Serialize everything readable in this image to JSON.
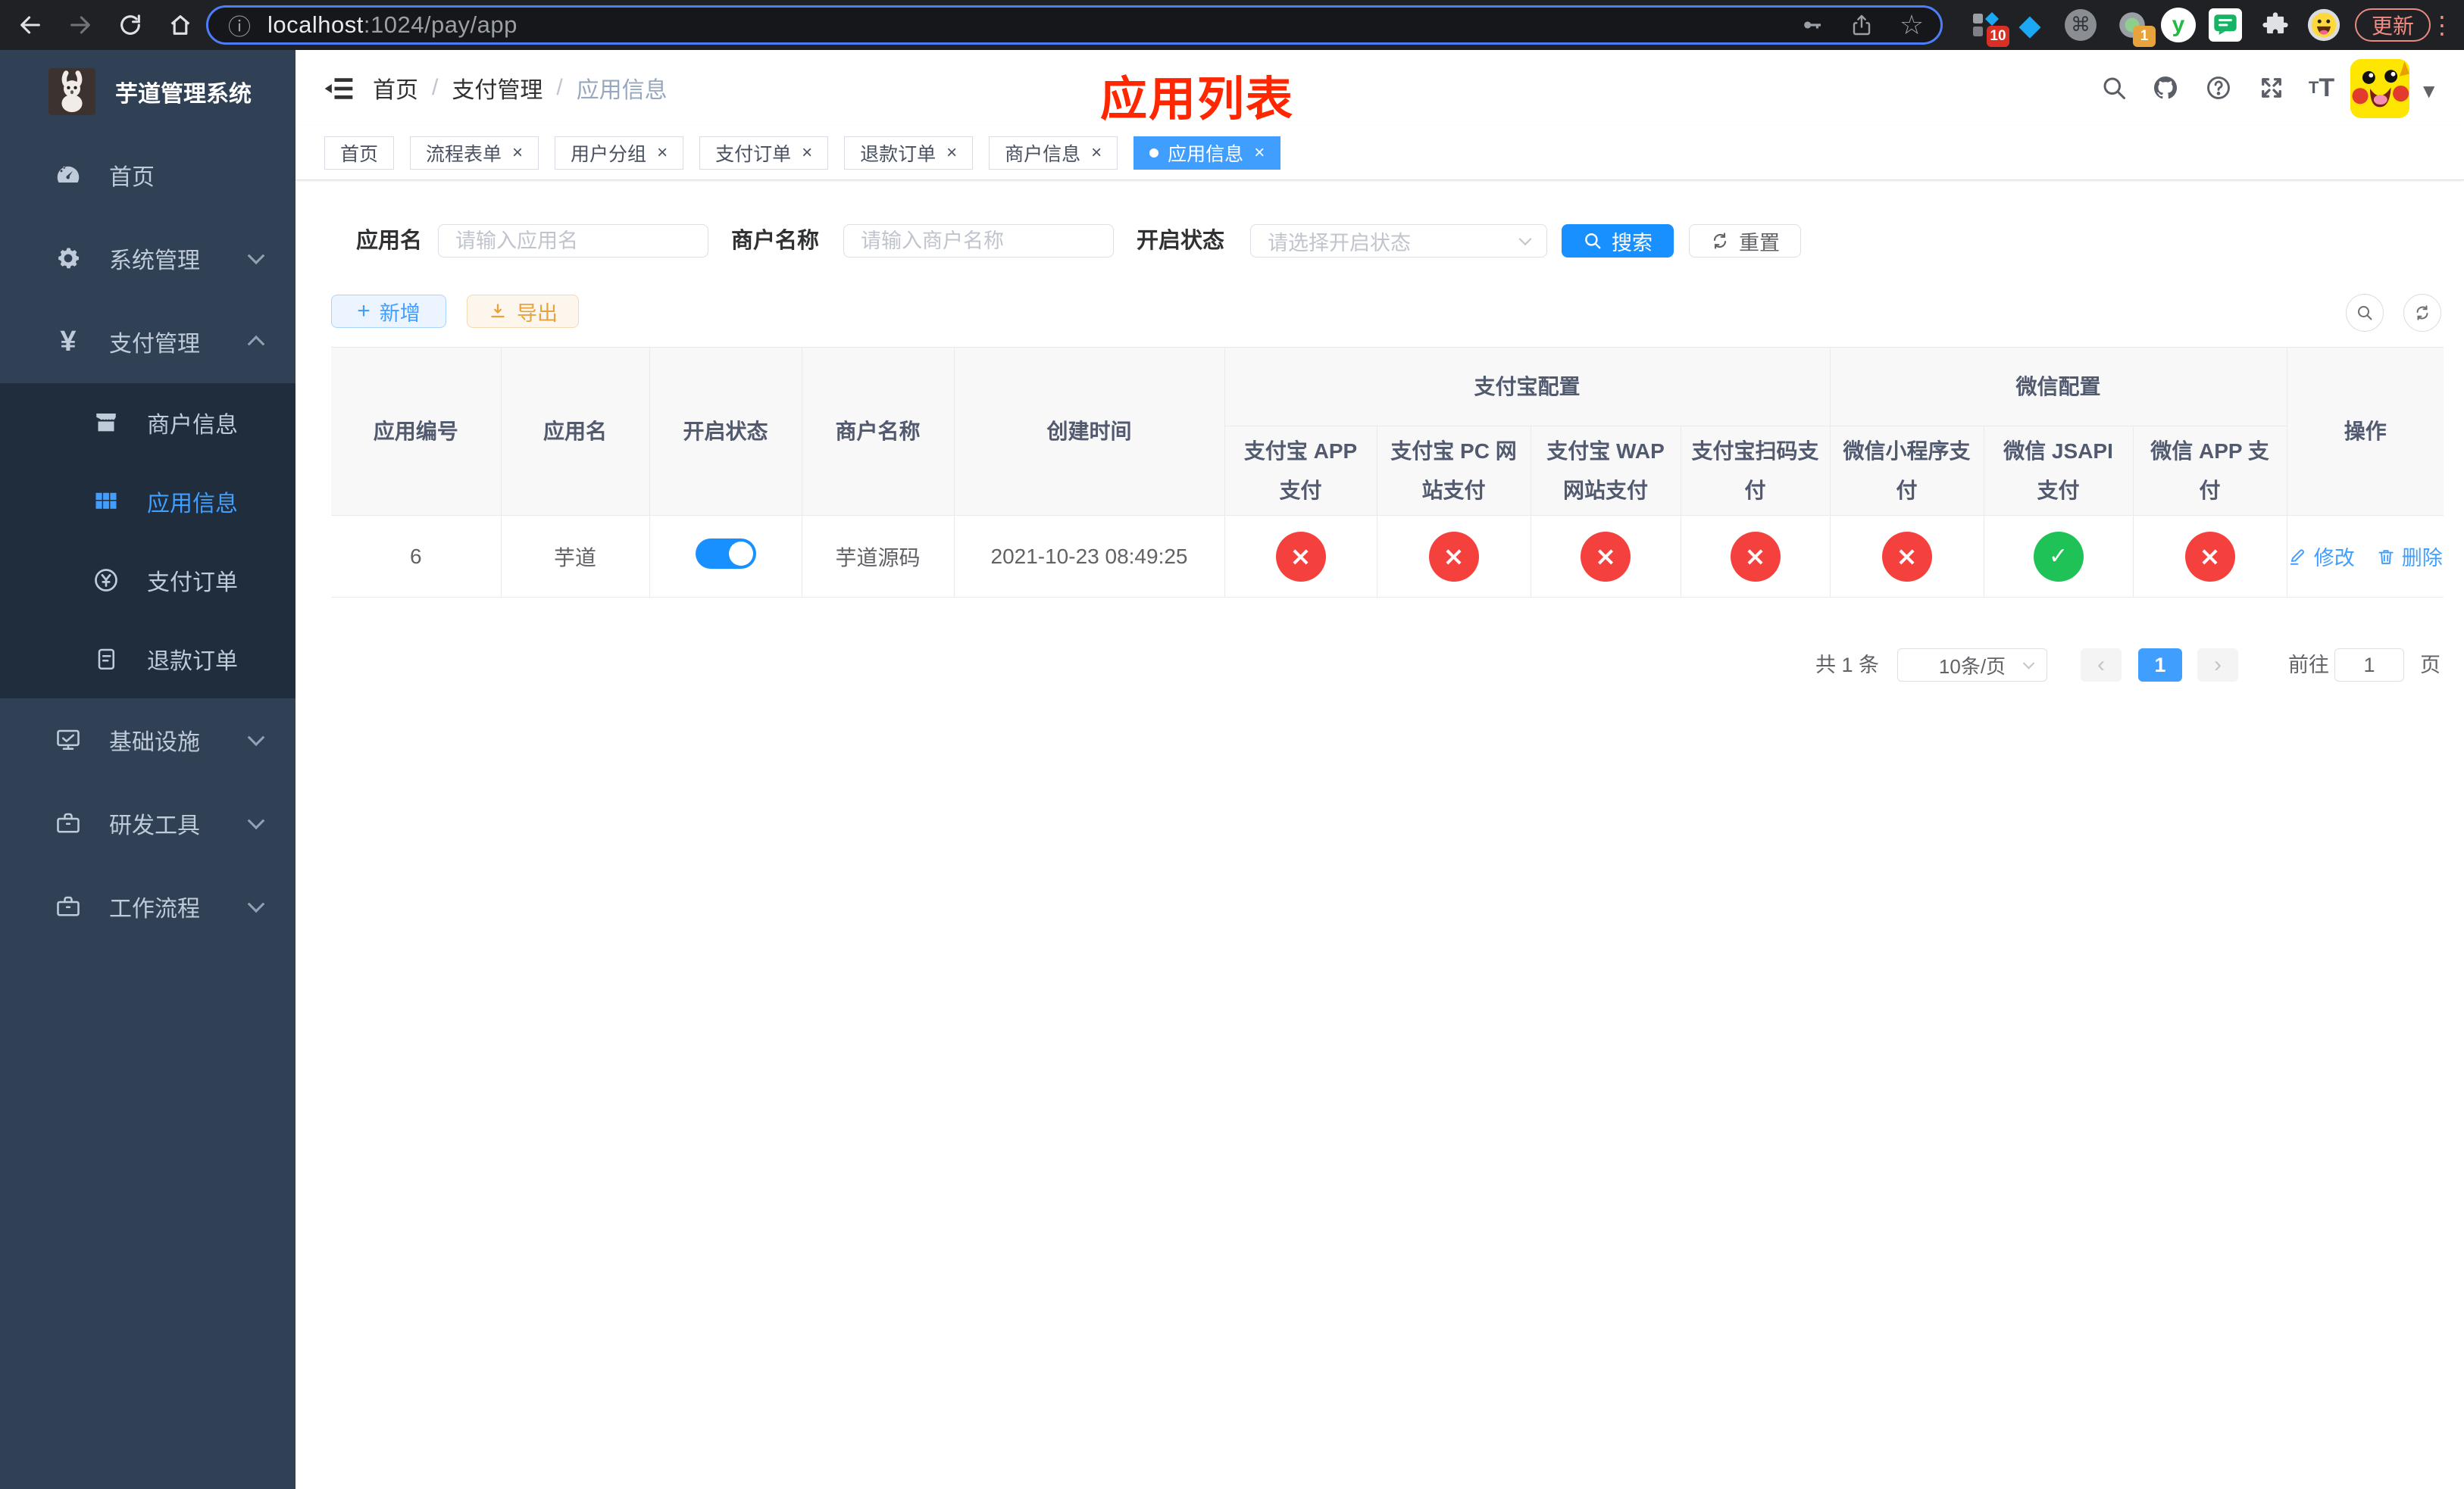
{
  "browser": {
    "url_host": "localhost",
    "url_rest": ":1024/pay/app",
    "update_label": "更新",
    "ext_badge_blocks": "10",
    "ext_badge_dot": "1"
  },
  "sidebar": {
    "logo_title": "芋道管理系统",
    "menu": [
      {
        "label": "首页"
      },
      {
        "label": "系统管理"
      },
      {
        "label": "支付管理"
      },
      {
        "label": "商户信息"
      },
      {
        "label": "应用信息"
      },
      {
        "label": "支付订单"
      },
      {
        "label": "退款订单"
      },
      {
        "label": "基础设施"
      },
      {
        "label": "研发工具"
      },
      {
        "label": "工作流程"
      }
    ]
  },
  "header": {
    "breadcrumb": [
      "首页",
      "支付管理",
      "应用信息"
    ],
    "separator": "/",
    "overlay_title": "应用列表"
  },
  "tabs": [
    {
      "label": "首页"
    },
    {
      "label": "流程表单"
    },
    {
      "label": "用户分组"
    },
    {
      "label": "支付订单"
    },
    {
      "label": "退款订单"
    },
    {
      "label": "商户信息"
    },
    {
      "label": "应用信息"
    }
  ],
  "filters": {
    "app_name_label": "应用名",
    "app_name_placeholder": "请输入应用名",
    "merchant_label": "商户名称",
    "merchant_placeholder": "请输入商户名称",
    "status_label": "开启状态",
    "status_placeholder": "请选择开启状态",
    "search_label": "搜索",
    "reset_label": "重置"
  },
  "toolbar": {
    "add_label": "新增",
    "export_label": "导出"
  },
  "table": {
    "columns": {
      "app_id": "应用编号",
      "app_name": "应用名",
      "status": "开启状态",
      "merchant": "商户名称",
      "created": "创建时间",
      "alipay_group": "支付宝配置",
      "alipay": [
        "支付宝 APP 支付",
        "支付宝 PC 网站支付",
        "支付宝 WAP 网站支付",
        "支付宝扫码支付"
      ],
      "wechat_group": "微信配置",
      "wechat": [
        "微信小程序支付",
        "微信 JSAPI 支付",
        "微信 APP 支付"
      ],
      "actions": "操作"
    },
    "rows": [
      {
        "app_id": "6",
        "app_name": "芋道",
        "enabled": "on",
        "merchant": "芋道源码",
        "created": "2021-10-23 08:49:25",
        "channels": {
          "alipay_app": "no",
          "alipay_pc": "no",
          "alipay_wap": "no",
          "alipay_qr": "no",
          "wx_lite": "no",
          "wx_jsapi": "yes",
          "wx_app": "no"
        },
        "edit_label": "修改",
        "delete_label": "删除"
      }
    ]
  },
  "pagination": {
    "total": "共 1 条",
    "page_size": "10条/页",
    "current_page": "1",
    "goto_label": "前往",
    "goto_value": "1",
    "page_suffix": "页"
  },
  "colors": {
    "accent": "#409eff",
    "primary_button": "#1890ff",
    "danger": "#f5413d",
    "success": "#1fc257",
    "warning": "#e6a23c",
    "title_red": "#ff2600",
    "sidebar_bg": "#304156",
    "submenu_bg": "#1f2d3d"
  }
}
